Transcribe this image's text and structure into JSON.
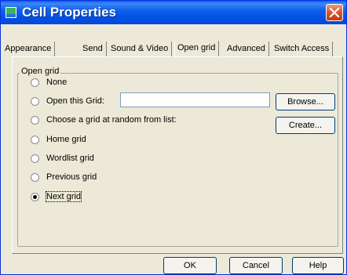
{
  "window": {
    "title": "Cell Properties"
  },
  "tabs": [
    {
      "label": "Appearance",
      "active": false
    },
    {
      "label": "Send",
      "active": false
    },
    {
      "label": "Sound & Video",
      "active": false
    },
    {
      "label": "Open grid",
      "active": true
    },
    {
      "label": "Advanced",
      "active": false
    },
    {
      "label": "Switch Access",
      "active": false
    }
  ],
  "open_grid": {
    "group_label": "Open grid",
    "options": [
      {
        "label": "None",
        "selected": false
      },
      {
        "label": "Open this Grid:",
        "selected": false
      },
      {
        "label": "Choose a grid at random from list:",
        "selected": false
      },
      {
        "label": "Home grid",
        "selected": false
      },
      {
        "label": "Wordlist grid",
        "selected": false
      },
      {
        "label": "Previous grid",
        "selected": false
      },
      {
        "label": "Next grid",
        "selected": true
      }
    ],
    "grid_name_value": "",
    "browse_label": "Browse...",
    "create_label": "Create..."
  },
  "footer": {
    "ok_label": "OK",
    "cancel_label": "Cancel",
    "help_label": "Help"
  },
  "colors": {
    "title_blue": "#0052e5",
    "dialog_face": "#ece9d8",
    "close_red": "#d5552c"
  }
}
